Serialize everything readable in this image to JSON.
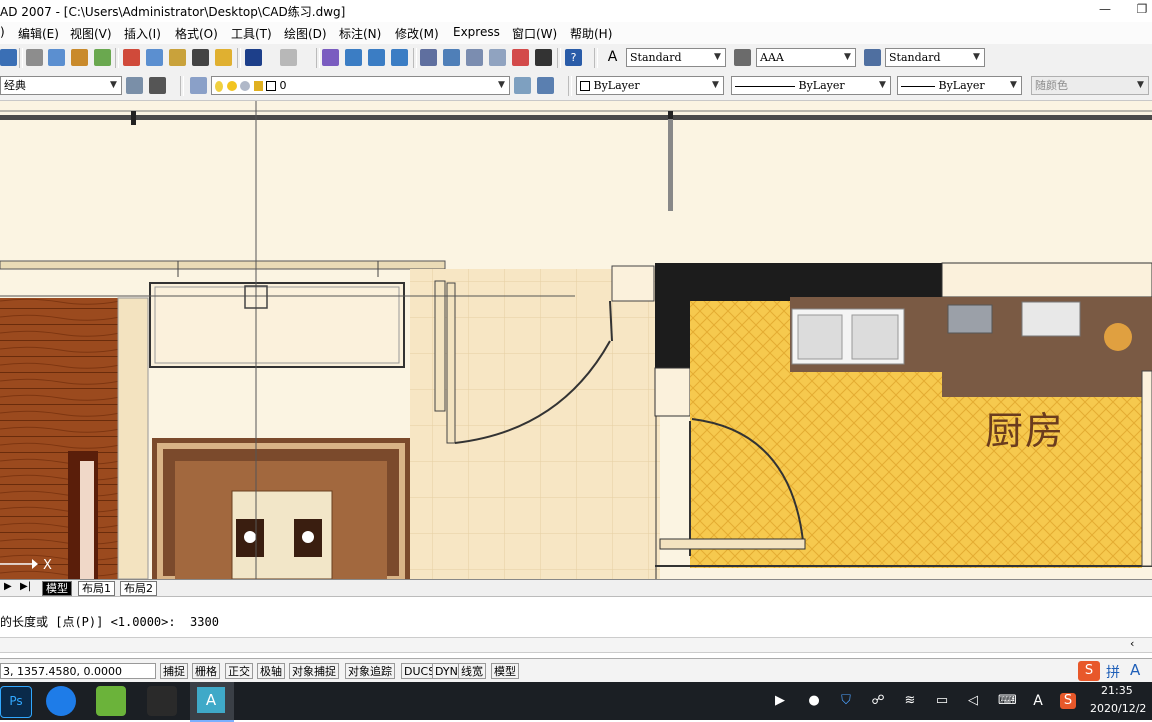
{
  "window": {
    "title": "AD 2007 - [C:\\Users\\Administrator\\Desktop\\CAD练习.dwg]",
    "minimize_icon": "minimize-icon",
    "restore_icon": "restore-icon"
  },
  "menu": [
    "编辑(E)",
    "视图(V)",
    "插入(I)",
    "格式(O)",
    "工具(T)",
    "绘图(D)",
    "标注(N)",
    "修改(M)",
    "Express",
    "窗口(W)",
    "帮助(H)"
  ],
  "styles": {
    "text_style": "Standard",
    "dim_style": "AAA",
    "table_style": "Standard"
  },
  "properties": {
    "workspace": "经典",
    "layer": "0",
    "color": "ByLayer",
    "linetype": "ByLayer",
    "lineweight": "ByLayer",
    "plotstyle": "随颜色"
  },
  "drawing": {
    "room_label": "厨房",
    "ucs_x": "X",
    "colors": {
      "canvas": "#fbf4e2",
      "wall": "#1c1c1c",
      "kitchen_floor": "#f6c94e",
      "wood_floor": "#9b4a1e",
      "tile": "#f7e6c4",
      "counter": "#7a5a44",
      "rug": "#7b4a2c"
    }
  },
  "layout_tabs": [
    "模型",
    "布局1",
    "布局2"
  ],
  "command": {
    "line": "的长度或 [点(P)] <1.0000>:  3300"
  },
  "status": {
    "coordinates": "3, 1357.4580, 0.0000",
    "toggles": [
      "捕捉",
      "栅格",
      "正交",
      "极轴",
      "对象捕捉",
      "对象追踪",
      "DUCS",
      "DYN",
      "线宽",
      "模型"
    ]
  },
  "taskbar": {
    "apps": [
      "photoshop-icon",
      "browser-icon",
      "file-app-icon",
      "game-icon",
      "autocad-icon"
    ],
    "ime_label": "拼",
    "ime_letter": "A",
    "tray_letter": "A",
    "time": "21:35",
    "date": "2020/12/2"
  }
}
